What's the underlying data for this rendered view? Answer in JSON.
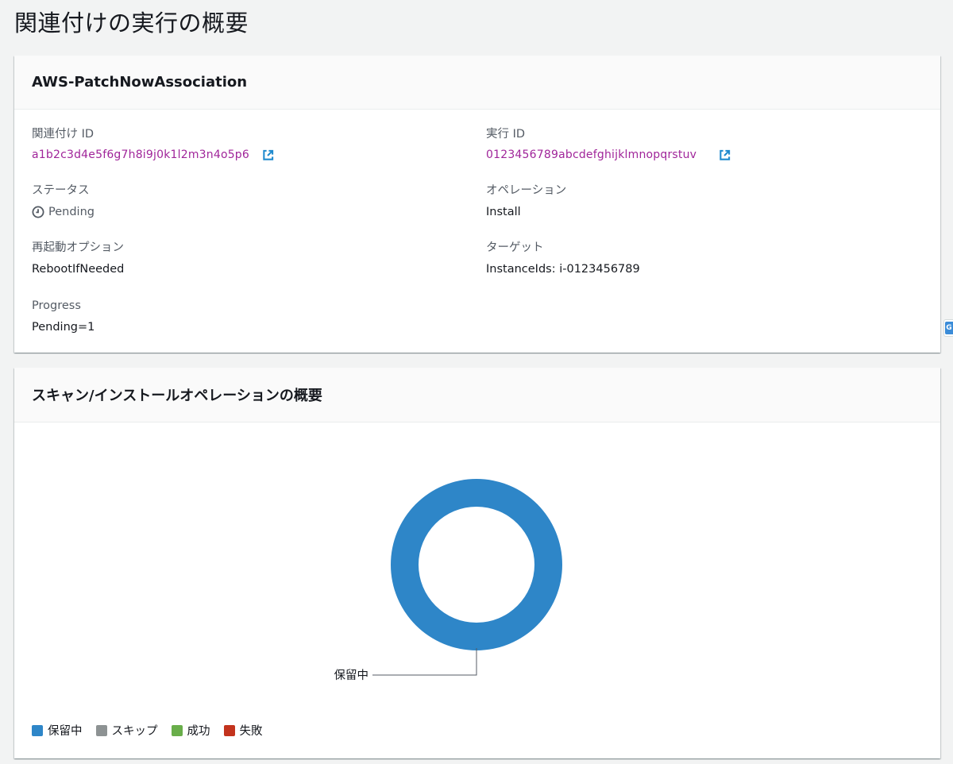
{
  "page": {
    "title": "関連付けの実行の概要"
  },
  "association_card": {
    "title": "AWS-PatchNowAssociation",
    "association_id": {
      "label": "関連付け ID",
      "value": "a1b2c3d4e5f6g7h8i9j0k1l2m3n4o5p6"
    },
    "execution_id": {
      "label": "実行 ID",
      "value": "0123456789abcdefghijklmnopqrstuv"
    },
    "status": {
      "label": "ステータス",
      "value": "Pending",
      "icon": "clock-icon"
    },
    "operation": {
      "label": "オペレーション",
      "value": "Install"
    },
    "reboot_option": {
      "label": "再起動オプション",
      "value": "RebootIfNeeded"
    },
    "target": {
      "label": "ターゲット",
      "value": "InstanceIds: i-0123456789"
    },
    "progress": {
      "label": "Progress",
      "value": "Pending=1"
    }
  },
  "summary_card": {
    "title": "スキャン/インストールオペレーションの概要",
    "chart_data": {
      "type": "pie",
      "categories": [
        "保留中",
        "スキップ",
        "成功",
        "失敗"
      ],
      "values": [
        1,
        0,
        0,
        0
      ],
      "colors": [
        "#2e86c8",
        "#8d9293",
        "#69ae4a",
        "#c3331d"
      ],
      "donut": true,
      "callout": "保留中",
      "legend_position": "bottom-left"
    }
  },
  "colors": {
    "link": "#a0259a",
    "icon_blue": "#1f8ace",
    "pending": "#2e86c8"
  },
  "side_tab": {
    "label": "G"
  }
}
